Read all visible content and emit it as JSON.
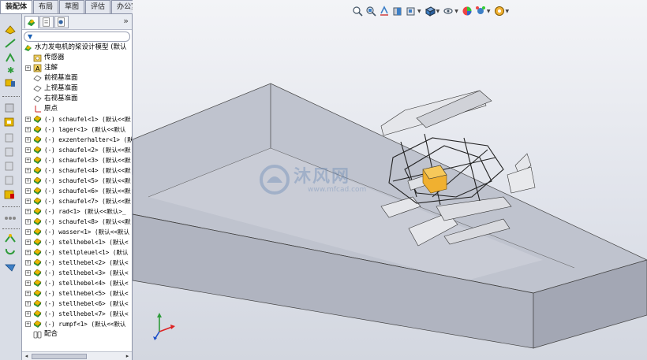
{
  "tabs": [
    {
      "label": "装配体",
      "active": true
    },
    {
      "label": "布局",
      "active": false
    },
    {
      "label": "草图",
      "active": false
    },
    {
      "label": "评估",
      "active": false
    },
    {
      "label": "办公室产品",
      "active": false
    }
  ],
  "panel": {
    "expand_glyph": "»",
    "filter_glyph": "▼"
  },
  "tree": {
    "root": "水力发电机的桨设计模型  (默认",
    "items": [
      {
        "label": "传感器",
        "icon": "sensor-folder-icon",
        "mono": false,
        "expander": false
      },
      {
        "label": "注解",
        "icon": "annotation-icon",
        "mono": false,
        "expander": true
      },
      {
        "label": "前视基准面",
        "icon": "plane-icon",
        "mono": false,
        "expander": false
      },
      {
        "label": "上视基准面",
        "icon": "plane-icon",
        "mono": false,
        "expander": false
      },
      {
        "label": "右视基准面",
        "icon": "plane-icon",
        "mono": false,
        "expander": false
      },
      {
        "label": "原点",
        "icon": "origin-icon",
        "mono": false,
        "expander": false
      },
      {
        "label": "(-) schaufel<1> (默认<<默",
        "icon": "part-icon",
        "mono": true,
        "expander": true
      },
      {
        "label": "(-) lager<1> (默认<<默认",
        "icon": "part-icon",
        "mono": true,
        "expander": true
      },
      {
        "label": "(-) exzenterhalter<1> (默",
        "icon": "part-icon",
        "mono": true,
        "expander": true
      },
      {
        "label": "(-) schaufel<2> (默认<<默",
        "icon": "part-icon",
        "mono": true,
        "expander": true
      },
      {
        "label": "(-) schaufel<3> (默认<<默",
        "icon": "part-icon",
        "mono": true,
        "expander": true
      },
      {
        "label": "(-) schaufel<4> (默认<<默",
        "icon": "part-icon",
        "mono": true,
        "expander": true
      },
      {
        "label": "(-) schaufel<5> (默认<<默",
        "icon": "part-icon",
        "mono": true,
        "expander": true
      },
      {
        "label": "(-) schaufel<6> (默认<<默",
        "icon": "part-icon",
        "mono": true,
        "expander": true
      },
      {
        "label": "(-) schaufel<7> (默认<<默",
        "icon": "part-icon",
        "mono": true,
        "expander": true
      },
      {
        "label": "(-) rad<1> (默认<<默认>_",
        "icon": "part-icon",
        "mono": true,
        "expander": true
      },
      {
        "label": "(-) schaufel<8> (默认<<默",
        "icon": "part-icon",
        "mono": true,
        "expander": true
      },
      {
        "label": "(-) wasser<1> (默认<<默认",
        "icon": "part-icon",
        "mono": true,
        "expander": true
      },
      {
        "label": "(-) stellhebel<1> (默认<",
        "icon": "part-icon",
        "mono": true,
        "expander": true
      },
      {
        "label": "(-) stellpleuel<1> (默认",
        "icon": "part-icon",
        "mono": true,
        "expander": true
      },
      {
        "label": "(-) stellhebel<2> (默认<",
        "icon": "part-icon",
        "mono": true,
        "expander": true
      },
      {
        "label": "(-) stellhebel<3> (默认<",
        "icon": "part-icon",
        "mono": true,
        "expander": true
      },
      {
        "label": "(-) stellhebel<4> (默认<",
        "icon": "part-icon",
        "mono": true,
        "expander": true
      },
      {
        "label": "(-) stellhebel<5> (默认<",
        "icon": "part-icon",
        "mono": true,
        "expander": true
      },
      {
        "label": "(-) stellhebel<6> (默认<",
        "icon": "part-icon",
        "mono": true,
        "expander": true
      },
      {
        "label": "(-) stellhebel<7> (默认<",
        "icon": "part-icon",
        "mono": true,
        "expander": true
      },
      {
        "label": "(-) rumpf<1> (默认<<默认",
        "icon": "part-icon",
        "mono": true,
        "expander": true
      },
      {
        "label": "配合",
        "icon": "mates-icon",
        "mono": false,
        "expander": false
      }
    ]
  },
  "watermark": {
    "main": "沐风网",
    "sub": "www.mfcad.com"
  },
  "colors": {
    "part_yellow": "#e6b800",
    "part_green": "#2e9b3a",
    "selected_part": "#f0b030",
    "box_top": "#b8bcc8",
    "box_side": "#a6aab8"
  }
}
